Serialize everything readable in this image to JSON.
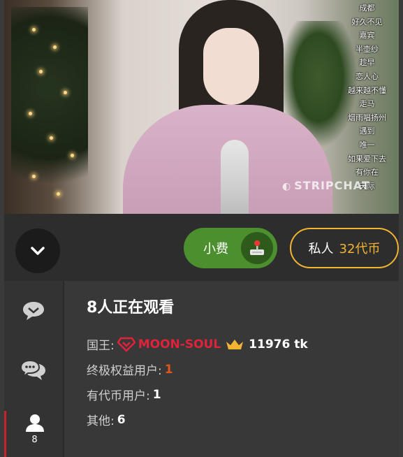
{
  "video": {
    "songs": [
      "成都",
      "好久不见",
      "嘉宾",
      "半壶纱",
      "趁早",
      "恋人心",
      "越来越不懂",
      "走马",
      "烟雨唱扬州",
      "遇到",
      "唯一",
      "如果爱下去",
      "有你在",
      "天际"
    ],
    "watermark": "STRIPCHAT"
  },
  "controls": {
    "collapse_icon": "chevron-down-icon",
    "tip_label": "小费",
    "tip_icon": "joystick-icon",
    "private_label": "私人",
    "private_price": "32代币",
    "colors": {
      "tip_bg": "#4b8f2e",
      "private_border": "#f2b532"
    }
  },
  "sidebar": {
    "items": [
      {
        "icon": "chat-bubble-icon"
      },
      {
        "icon": "private-chat-icon"
      },
      {
        "icon": "user-icon",
        "count": "8"
      }
    ]
  },
  "viewers": {
    "title": "8人正在观看",
    "king_label": "国王:",
    "king_name": "MOON-SOUL",
    "king_tokens": "11976 tk",
    "ultimate_label": "终极权益用户:",
    "ultimate_count": "1",
    "token_users_label": "有代币用户:",
    "token_users_count": "1",
    "others_label": "其他:",
    "others_count": "6"
  }
}
